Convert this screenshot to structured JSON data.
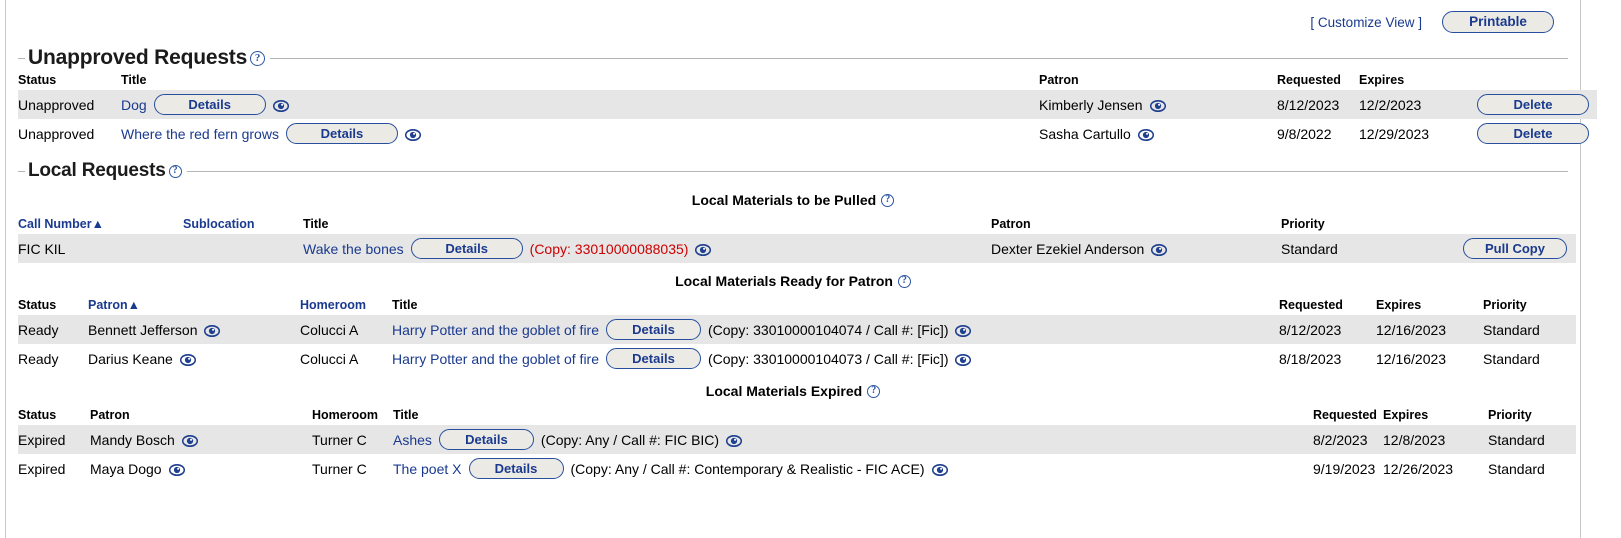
{
  "toolbar": {
    "customize_view_open": "[",
    "customize_view": "Customize View",
    "customize_view_close": "]",
    "printable": "Printable"
  },
  "colors": {
    "link": "#1a3a8f",
    "accent": "#274f9e",
    "stripe": "#e6e6e6",
    "alert": "#cc0000",
    "button_face": "#eceae4"
  },
  "unapproved": {
    "legend": "Unapproved Requests",
    "help": "?",
    "columns": {
      "status": "Status",
      "title": "Title",
      "patron": "Patron",
      "requested": "Requested",
      "expires": "Expires"
    },
    "details_label": "Details",
    "delete_label": "Delete",
    "rows": [
      {
        "status": "Unapproved",
        "title": "Dog",
        "patron": "Kimberly Jensen",
        "requested": "8/12/2023",
        "expires": "12/2/2023"
      },
      {
        "status": "Unapproved",
        "title": "Where the red fern grows",
        "patron": "Sasha Cartullo",
        "requested": "9/8/2022",
        "expires": "12/29/2023"
      }
    ]
  },
  "local_requests": {
    "legend": "Local Requests",
    "help": "?",
    "to_be_pulled": {
      "heading": "Local Materials to be Pulled",
      "help": "?",
      "columns": {
        "call_number": "Call Number",
        "sort_arrow": "▲",
        "sublocation": "Sublocation",
        "title": "Title",
        "patron": "Patron",
        "priority": "Priority"
      },
      "details_label": "Details",
      "pull_copy_label": "Pull Copy",
      "rows": [
        {
          "call_number": "FIC KIL",
          "sublocation": "",
          "title": "Wake the bones",
          "copy_info": "(Copy: 33010000088035)",
          "patron": "Dexter Ezekiel Anderson",
          "priority": "Standard"
        }
      ]
    },
    "ready_for_patron": {
      "heading": "Local Materials Ready for Patron",
      "help": "?",
      "columns": {
        "status": "Status",
        "patron": "Patron",
        "sort_arrow": "▲",
        "homeroom": "Homeroom",
        "title": "Title",
        "requested": "Requested",
        "expires": "Expires",
        "priority": "Priority"
      },
      "details_label": "Details",
      "rows": [
        {
          "status": "Ready",
          "patron": "Bennett Jefferson",
          "homeroom": "Colucci A",
          "title": "Harry Potter and the goblet of fire",
          "copy_info": "(Copy: 33010000104074 / Call #: [Fic])",
          "requested": "8/12/2023",
          "expires": "12/16/2023",
          "priority": "Standard"
        },
        {
          "status": "Ready",
          "patron": "Darius Keane",
          "homeroom": "Colucci A",
          "title": "Harry Potter and the goblet of fire",
          "copy_info": "(Copy: 33010000104073 / Call #: [Fic])",
          "requested": "8/18/2023",
          "expires": "12/16/2023",
          "priority": "Standard"
        }
      ]
    },
    "expired": {
      "heading": "Local Materials Expired",
      "help": "?",
      "columns": {
        "status": "Status",
        "patron": "Patron",
        "homeroom": "Homeroom",
        "title": "Title",
        "requested": "Requested",
        "expires": "Expires",
        "priority": "Priority"
      },
      "details_label": "Details",
      "rows": [
        {
          "status": "Expired",
          "patron": "Mandy Bosch",
          "homeroom": "Turner C",
          "title": "Ashes",
          "copy_info": "(Copy: Any / Call #: FIC BIC)",
          "requested": "8/2/2023",
          "expires": "12/8/2023",
          "priority": "Standard"
        },
        {
          "status": "Expired",
          "patron": "Maya Dogo",
          "homeroom": "Turner C",
          "title": "The poet X",
          "copy_info": "(Copy: Any / Call #: Contemporary & Realistic - FIC ACE)",
          "requested": "9/19/2023",
          "expires": "12/26/2023",
          "priority": "Standard"
        }
      ]
    }
  }
}
